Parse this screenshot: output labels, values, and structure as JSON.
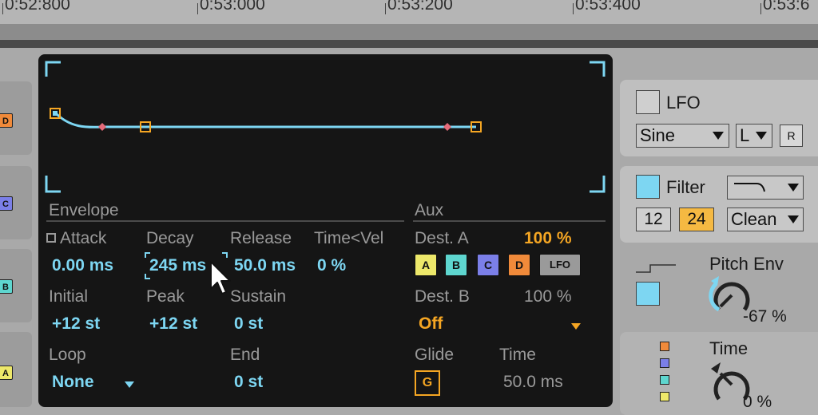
{
  "timeline": {
    "ticks": [
      "0:52:800",
      "0:53:000",
      "0:53:200",
      "0:53:400",
      "0:53:6"
    ]
  },
  "left_strip": {
    "tabs": [
      {
        "label": "D",
        "color": "#f08a3a"
      },
      {
        "label": "C",
        "color": "#7b7fe8"
      },
      {
        "label": "B",
        "color": "#5ed6cf"
      },
      {
        "label": "A",
        "color": "#ede86a"
      }
    ]
  },
  "envelope": {
    "section_title": "Envelope",
    "attack_label": "Attack",
    "attack_value": "0.00 ms",
    "decay_label": "Decay",
    "decay_value": "245 ms",
    "release_label": "Release",
    "release_value": "50.0 ms",
    "time_vel_label": "Time<Vel",
    "time_vel_value": "0 %",
    "initial_label": "Initial",
    "initial_value": "+12 st",
    "peak_label": "Peak",
    "peak_value": "+12 st",
    "sustain_label": "Sustain",
    "sustain_value": "0 st",
    "loop_label": "Loop",
    "loop_value": "None",
    "end_label": "End",
    "end_value": "0 st"
  },
  "aux": {
    "section_title": "Aux",
    "dest_a_label": "Dest. A",
    "dest_a_value": "100 %",
    "dest_buttons": [
      {
        "label": "A",
        "color": "#ede86a"
      },
      {
        "label": "B",
        "color": "#5ed6cf"
      },
      {
        "label": "C",
        "color": "#7b7fe8"
      },
      {
        "label": "D",
        "color": "#f08a3a"
      },
      {
        "label": "LFO",
        "color": "#9a9a9a"
      }
    ],
    "dest_b_label": "Dest. B",
    "dest_b_value": "100 %",
    "dest_b_select": "Off",
    "glide_label": "Glide",
    "glide_button": "G",
    "time_label": "Time",
    "time_value": "50.0 ms"
  },
  "right": {
    "lfo_label": "LFO",
    "lfo_wave": "Sine",
    "lfo_channel": "L",
    "lfo_retrigger": "R",
    "filter_label": "Filter",
    "filter_slope_12": "12",
    "filter_slope_24": "24",
    "filter_mode": "Clean",
    "pitch_env_label": "Pitch Env",
    "pitch_env_value": "-67 %",
    "time_label": "Time",
    "time_value": "0 %",
    "mini_chip_colors": [
      "#f08a3a",
      "#7b7fe8",
      "#5ed6cf",
      "#ede86a"
    ]
  },
  "colors": {
    "accent_blue": "#7dd6f2",
    "accent_orange": "#f5a623",
    "panel_bg": "#151515"
  }
}
